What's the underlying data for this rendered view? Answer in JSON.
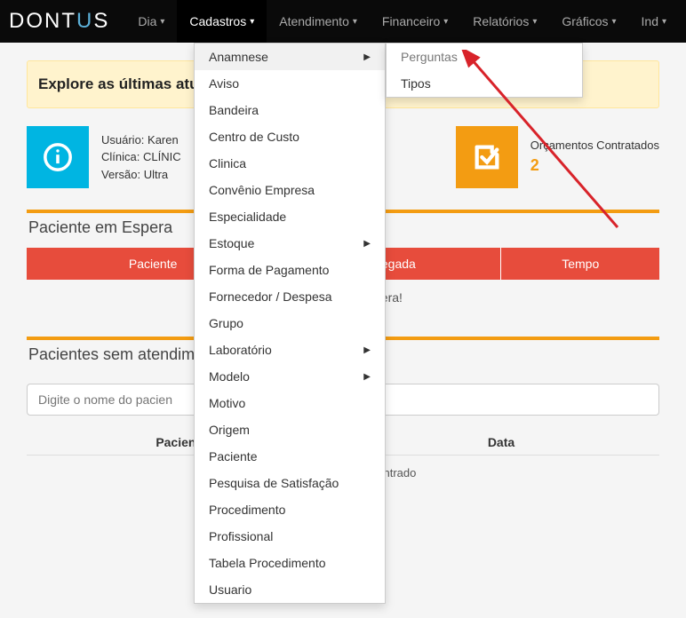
{
  "brand": {
    "part1": "DONT",
    "dot": "U",
    "part2": "S"
  },
  "nav": [
    {
      "label": "Dia",
      "active": false
    },
    {
      "label": "Cadastros",
      "active": true
    },
    {
      "label": "Atendimento",
      "active": false
    },
    {
      "label": "Financeiro",
      "active": false
    },
    {
      "label": "Relatórios",
      "active": false
    },
    {
      "label": "Gráficos",
      "active": false
    },
    {
      "label": "Ind",
      "active": false
    }
  ],
  "banner": "Explore as últimas atualizações do Dontus e descubra muito mais! Cliq",
  "info_card": {
    "line1": "Usuário: Karen",
    "line2": "Clínica: CLÍNIC",
    "line3": "Versão: Ultra"
  },
  "orc_card": {
    "title": "Orçamentos Contratados",
    "value": "2"
  },
  "section_wait": {
    "title": "Paciente em Espera",
    "columns": [
      "Paciente",
      "Chegada",
      "Tempo"
    ],
    "empty": "pacientes em espera!"
  },
  "section_noatt": {
    "title": "Pacientes sem atendim",
    "search_placeholder": "Digite o nome do pacien",
    "columns": [
      "Pacientes",
      "Data"
    ],
    "empty": "Nenhum registro encontrado"
  },
  "dropdown_cadastros": [
    {
      "label": "Anamnese",
      "has_sub": true,
      "hovered": true
    },
    {
      "label": "Aviso"
    },
    {
      "label": "Bandeira"
    },
    {
      "label": "Centro de Custo"
    },
    {
      "label": "Clinica"
    },
    {
      "label": "Convênio Empresa"
    },
    {
      "label": "Especialidade"
    },
    {
      "label": "Estoque",
      "has_sub": true
    },
    {
      "label": "Forma de Pagamento"
    },
    {
      "label": "Fornecedor / Despesa"
    },
    {
      "label": "Grupo"
    },
    {
      "label": "Laboratório",
      "has_sub": true
    },
    {
      "label": "Modelo",
      "has_sub": true
    },
    {
      "label": "Motivo"
    },
    {
      "label": "Origem"
    },
    {
      "label": "Paciente"
    },
    {
      "label": "Pesquisa de Satisfação"
    },
    {
      "label": "Procedimento"
    },
    {
      "label": "Profissional"
    },
    {
      "label": "Tabela Procedimento"
    },
    {
      "label": "Usuario"
    }
  ],
  "submenu_anamnese": [
    {
      "label": "Perguntas",
      "hov": true
    },
    {
      "label": "Tipos"
    }
  ],
  "colors": {
    "accent_orange": "#f39c12",
    "accent_red": "#e74c3c",
    "accent_blue": "#00b5e2",
    "arrow": "#d8232a"
  }
}
